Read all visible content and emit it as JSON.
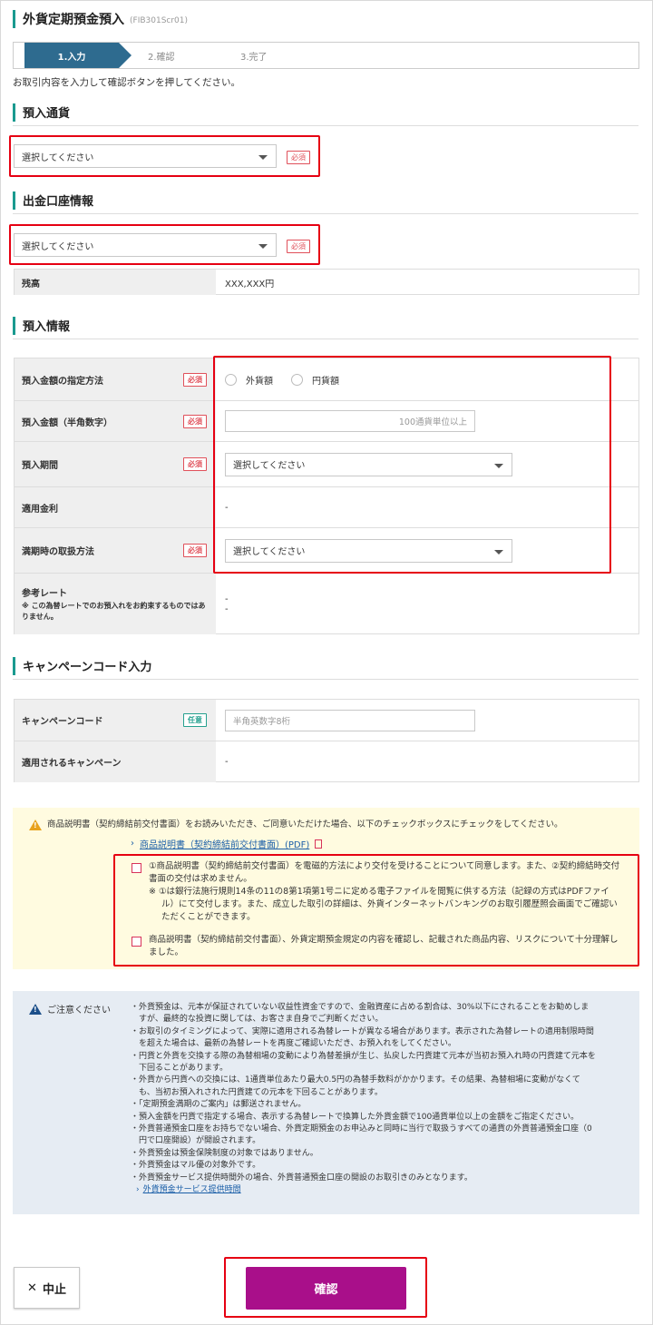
{
  "page": {
    "title": "外貨定期預金預入",
    "screen_code": "(FIB301Scr01)",
    "instruction": "お取引内容を入力して確認ボタンを押してください。"
  },
  "steps": [
    {
      "label": "1.入力",
      "active": true
    },
    {
      "label": "2.確認",
      "active": false
    },
    {
      "label": "3.完了",
      "active": false
    }
  ],
  "labels": {
    "required": "必須",
    "optional": "任意"
  },
  "currency_section": {
    "heading": "預入通貨",
    "select_value": "選択してください"
  },
  "account_section": {
    "heading": "出金口座情報",
    "select_value": "選択してください",
    "balance_label": "残高",
    "balance_value": "XXX,XXX円"
  },
  "deposit_section": {
    "heading": "預入情報",
    "method_label": "預入金額の指定方法",
    "method_options": [
      "外貨額",
      "円貨額"
    ],
    "amount_label": "預入金額（半角数字）",
    "amount_placeholder": "100通貨単位以上",
    "period_label": "預入期間",
    "period_value": "選択してください",
    "rate_label": "適用金利",
    "rate_value": "-",
    "maturity_label": "満期時の取扱方法",
    "maturity_value": "選択してください",
    "ref_rate_label": "参考レート",
    "ref_rate_note": "※ この為替レートでのお預入れをお約束するものではありません。",
    "ref_rate_value1": "-",
    "ref_rate_value2": "-"
  },
  "campaign_section": {
    "heading": "キャンペーンコード入力",
    "code_label": "キャンペーンコード",
    "code_placeholder": "半角英数字8桁",
    "applied_label": "適用されるキャンペーン",
    "applied_value": "-"
  },
  "agreement": {
    "warning_text": "商品説明書（契約締結前交付書面）をお読みいただき、ご同意いただけた場合、以下のチェックボックスにチェックをしてください。",
    "pdf_link": "商品説明書（契約締結前交付書面）(PDF)",
    "check1_line1": "①商品説明書（契約締結前交付書面）を電磁的方法により交付を受けることについて同意します。また、②契約締結時交付",
    "check1_line2": "書面の交付は求めません。",
    "check1_note1": "※ ①は銀行法施行規則14条の11の8第1項第1号ニに定める電子ファイルを閲覧に供する方法（記録の方式はPDFファイ",
    "check1_note2": "ル）にて交付します。また、成立した取引の詳細は、外貨インターネットバンキングのお取引履歴照会画面でご確認い",
    "check1_note3": "ただくことができます。",
    "check2_line1": "商品説明書（契約締結前交付書面）、外貨定期預金規定の内容を確認し、記載された商品内容、リスクについて十分理解し",
    "check2_line2": "ました。"
  },
  "caution": {
    "heading": "ご注意ください",
    "items": [
      "・外貨預金は、元本が保証されていない収益性資金ですので、金融資産に占める割合は、30%以下にされることをお勧めしま",
      "　すが、最終的な投資に関しては、お客さま自身でご判断ください。",
      "・お取引のタイミングによって、実際に適用される為替レートが異なる場合があります。表示された為替レートの適用制限時間",
      "　を超えた場合は、最新の為替レートを再度ご確認いただき、お預入れをしてください。",
      "・円貨と外貨を交換する際の為替相場の変動により為替差損が生じ、払戻した円貨建て元本が当初お預入れ時の円貨建て元本を",
      "　下回ることがあります。",
      "・外貨から円貨への交換には、1通貨単位あたり最大0.5円の為替手数料がかかります。その結果、為替相場に変動がなくて",
      "　も、当初お預入れされた円貨建ての元本を下回ることがあります。",
      "・「定期預金満期のご案内」は郵送されません。",
      "・預入金額を円貨で指定する場合、表示する為替レートで換算した外貨金額で100通貨単位以上の金額をご指定ください。",
      "・外貨普通預金口座をお持ちでない場合、外貨定期預金のお申込みと同時に当行で取扱うすべての通貨の外貨普通預金口座（0",
      "　円で口座開設）が開設されます。",
      "・外貨預金は預金保険制度の対象ではありません。",
      "・外貨預金はマル優の対象外です。",
      "・外貨預金サービス提供時間外の場合、外貨普通預金口座の開設のお取引きのみとなります。"
    ],
    "link": "外貨預金サービス提供時間"
  },
  "buttons": {
    "cancel": "中止",
    "confirm": "確認"
  },
  "colors": {
    "accent": "#1a9a8f",
    "step_active": "#2e6b8f",
    "confirm": "#a90f8a",
    "highlight": "#e60012",
    "required": "#e0505a"
  }
}
